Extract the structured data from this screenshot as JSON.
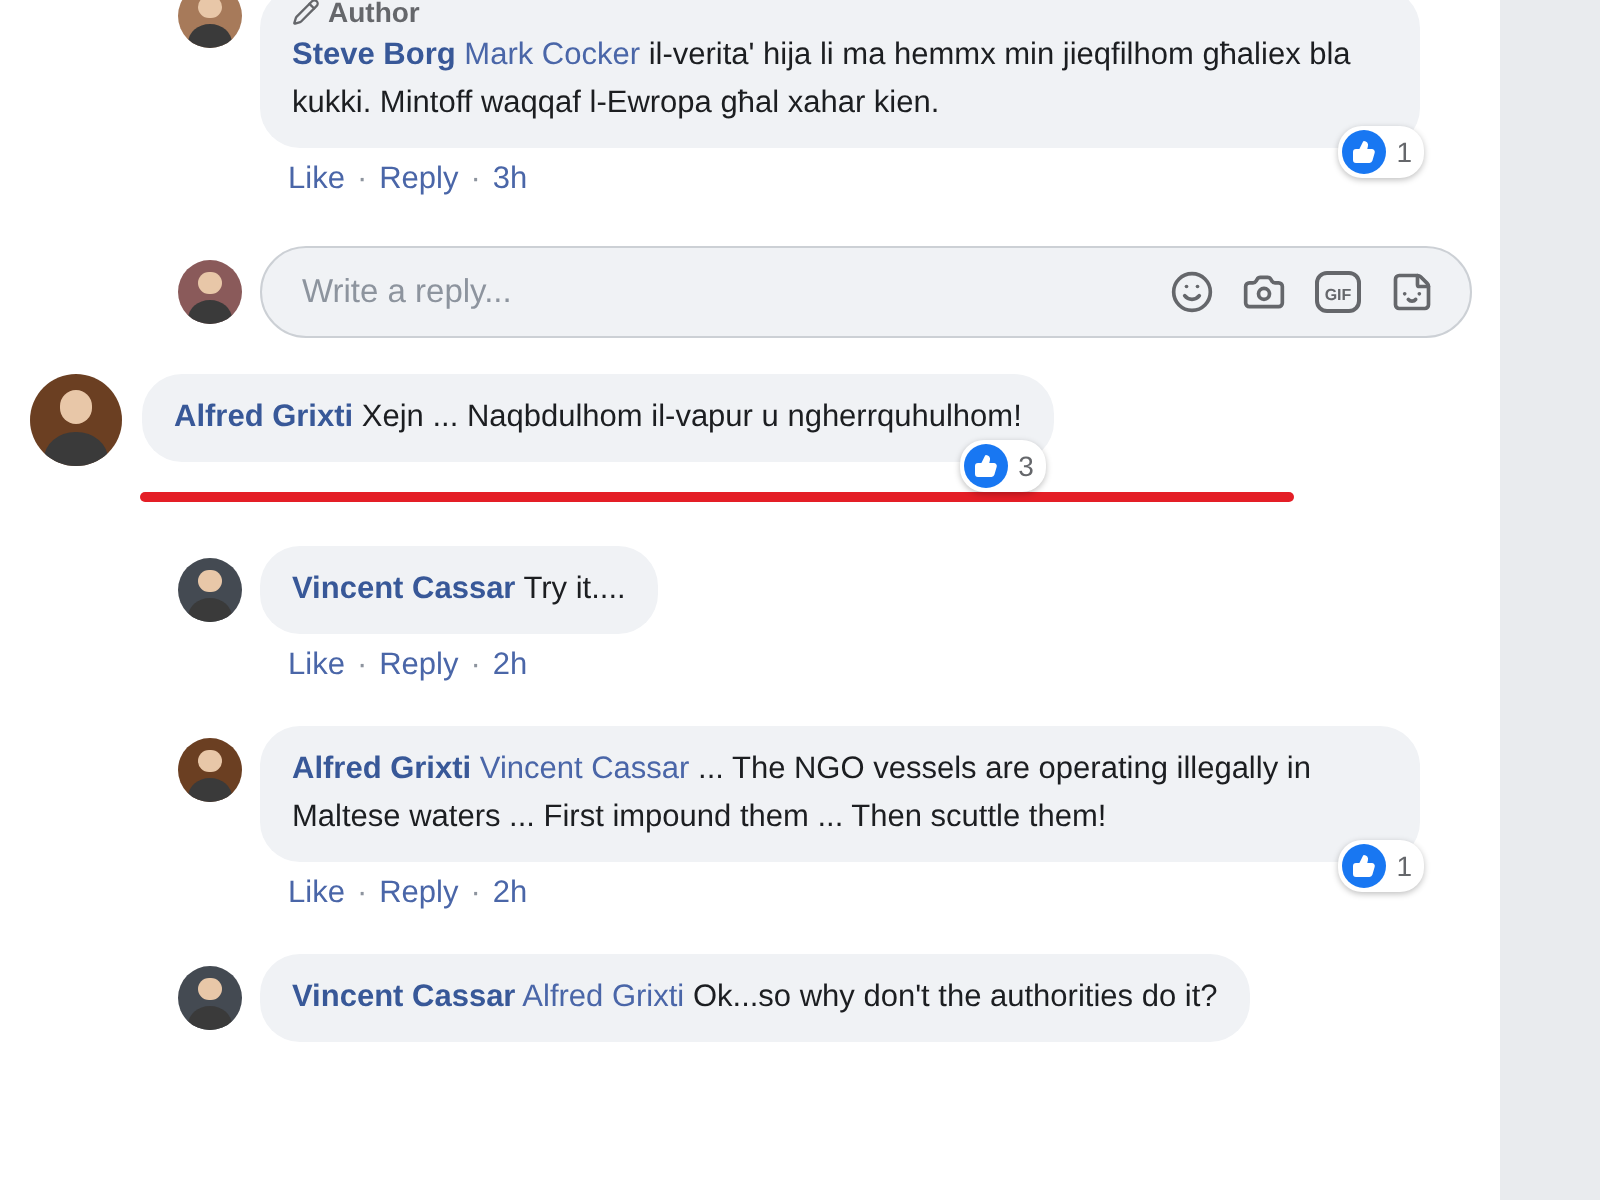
{
  "separator": "·",
  "earlier_replies": [
    {
      "author": "Steve Borg",
      "badge": "Author",
      "mention": "Mark Cocker",
      "text": "il-verita' hija li ma hemmx min jieqfilhom għaliex bla kukki. Mintoff waqqaf l-Ewropa għal xahar kien.",
      "reactions": "1",
      "actions": [
        "Like",
        "Reply"
      ],
      "time": "3h"
    }
  ],
  "reply_box": {
    "placeholder": "Write a reply...",
    "gif_label": "GIF"
  },
  "comments": [
    {
      "author": "Alfred Grixti",
      "text": "Xejn ... Naqbdulhom il-vapur u ngherrquhulhom!",
      "reactions": "3",
      "underlined": true,
      "replies": [
        {
          "author": "Vincent Cassar",
          "text": "Try it....",
          "actions": [
            "Like",
            "Reply"
          ],
          "time": "2h"
        },
        {
          "author": "Alfred Grixti",
          "mention": "Vincent Cassar",
          "text": "... The NGO vessels are operating illegally in Maltese waters ... First impound them ... Then scuttle them!",
          "reactions": "1",
          "actions": [
            "Like",
            "Reply"
          ],
          "time": "2h"
        },
        {
          "author": "Vincent Cassar",
          "mention": "Alfred Grixti",
          "text": "Ok...so why don't the authorities do it?"
        }
      ]
    }
  ]
}
